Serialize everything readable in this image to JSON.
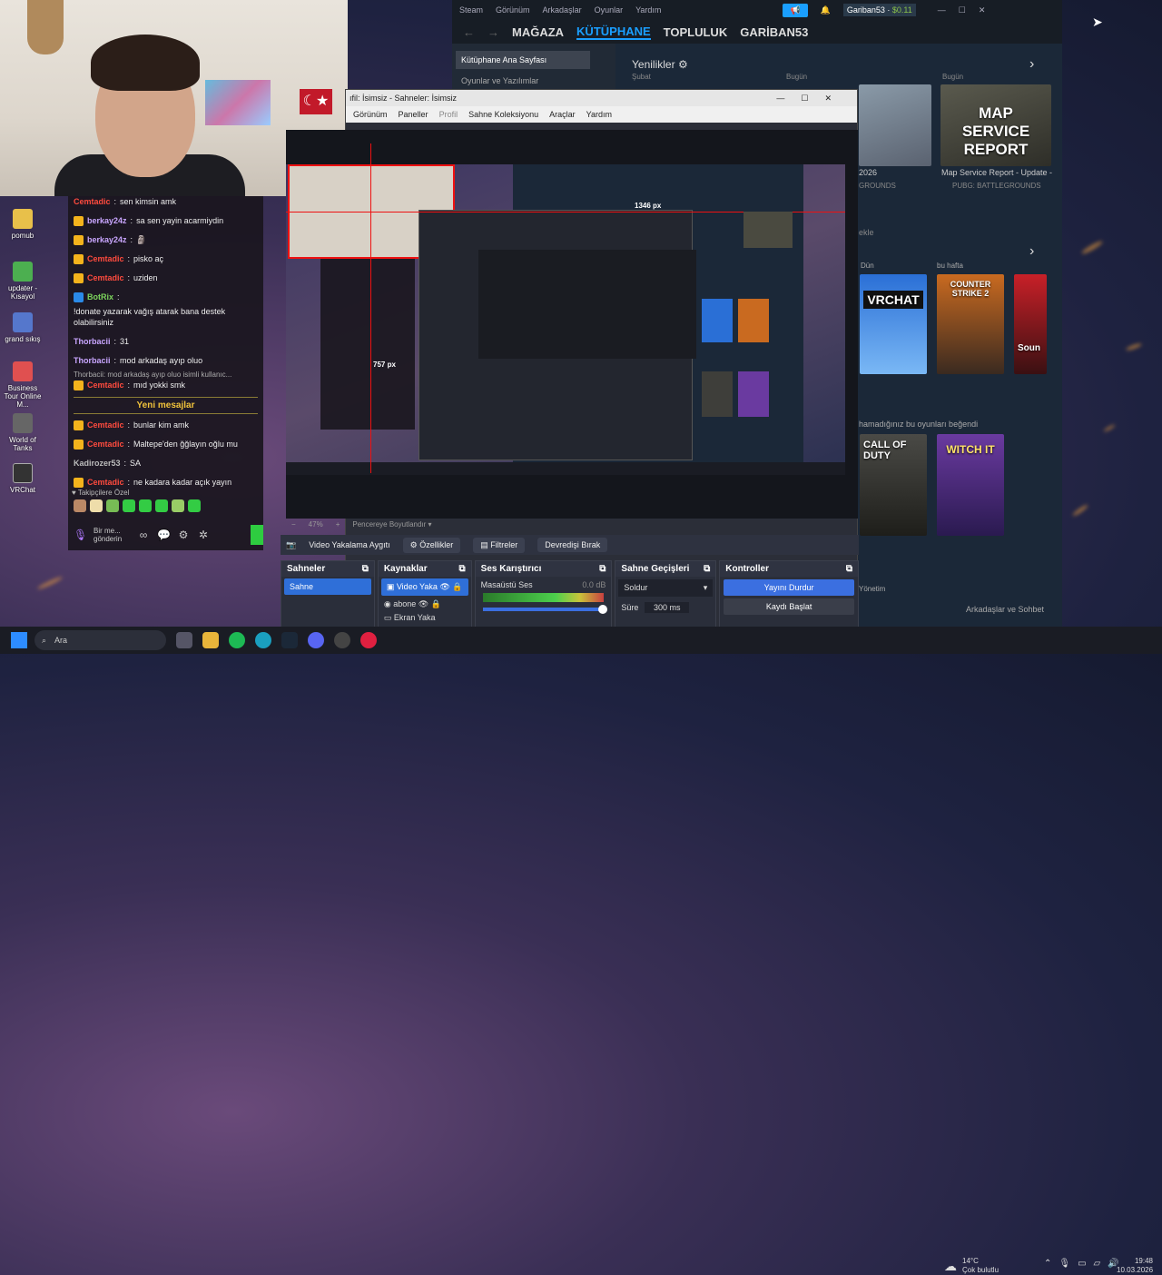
{
  "webcam": {
    "flag": "☾★"
  },
  "chat": {
    "messages": [
      {
        "user": "Cemtadic",
        "text": "sen kimsin amk",
        "color": "red"
      },
      {
        "user": "berkay24z",
        "text": "sa sen yayin acarmiydin",
        "color": "purple"
      },
      {
        "user": "berkay24z",
        "text": "🗿",
        "color": "purple"
      },
      {
        "user": "Cemtadic",
        "text": "pisko aç",
        "color": "red"
      },
      {
        "user": "Cemtadic",
        "text": "uziden",
        "color": "red"
      },
      {
        "user": "BotRix",
        "text": "!donate yazarak vağış atarak bana destek olabilirsiniz",
        "color": "green"
      },
      {
        "user": "Thorbacii",
        "text": "31",
        "color": "purple"
      },
      {
        "user": "Thorbacii",
        "text": "mod arkadaş ayıp oluo",
        "color": "purple"
      }
    ],
    "reply_preview": "Thorbacii: mod arkadaş ayıp oluo isimli kullanıc...",
    "reply_message": {
      "user": "Cemtadic",
      "text": "mıd yokki smk"
    },
    "new_messages_label": "Yeni mesajlar",
    "messages2": [
      {
        "user": "Cemtadic",
        "text": "bunlar kim amk",
        "color": "red"
      },
      {
        "user": "Cemtadic",
        "text": "Maltepe'den ğğlayın oğlu mu",
        "color": "red"
      },
      {
        "user": "Kadirozer53",
        "text": "SA",
        "color": "gray"
      },
      {
        "user": "Cemtadic",
        "text": "ne kadara kadar açık yayın",
        "color": "red"
      }
    ],
    "followers_label": "♥ Takipçilere Özel",
    "input_placeholder": "Bir me... gönderin"
  },
  "desktop_icons": [
    {
      "label": "pomub",
      "color": "#e8c04a"
    },
    {
      "label": "updater - Kısayol",
      "color": "#4caf50"
    },
    {
      "label": "grand sıkış",
      "color": "#5577cc"
    },
    {
      "label": "Business Tour Online M...",
      "color": "#e05050"
    },
    {
      "label": "World of Tanks",
      "color": "#666"
    },
    {
      "label": "VRChat",
      "color": "#333"
    }
  ],
  "steam": {
    "menu": [
      "Steam",
      "Görünüm",
      "Arkadaşlar",
      "Oyunlar",
      "Yardım"
    ],
    "user": "Gariban53",
    "wallet": "$0.11",
    "nav": [
      "MAĞAZA",
      "KÜTÜPHANE",
      "TOPLULUK",
      "GARİBAN53"
    ],
    "home_label": "Kütüphane Ana Sayfası",
    "filter_label": "Oyunlar ve Yazılımlar",
    "whats_new": "Yenilikler",
    "month_label": "Şubat",
    "today_label": "Bugün",
    "today_label2": "Bugün",
    "news_date": "2026",
    "news_source": "GROUNDS",
    "news_title": "Map Service Report - Update -",
    "news_game": "PUBG: BATTLEGROUNDS",
    "map_tile_text": "MAP SERVICE REPORT",
    "add_shelf": "ekle",
    "yesterday": "Dün",
    "this_week": "bu hafta",
    "unplayed": "hamadığınız bu oyunları beğendi",
    "vrchat": "VRCHAT",
    "cs2": "COUNTER STRIKE 2",
    "cod": "CALL OF DUTY",
    "witch": "WITCH IT",
    "sound": "Soun",
    "manage": "Yönetim",
    "friends_chat": "Arkadaşlar ve Sohbet"
  },
  "obs": {
    "title": "ıfil: İsimsiz - Sahneler: İsimsiz",
    "menu": [
      "Görünüm",
      "Paneller",
      "Profil",
      "Sahne Koleksiyonu",
      "Araçlar",
      "Yardım"
    ],
    "px_label": "1346 px",
    "px_label2": "757 px",
    "zoom": "47%",
    "zoom_mode": "Pencereye Boyutlandır",
    "source_name": "Video Yakalama Aygıtı",
    "props": "Özellikler",
    "filters": "Filtreler",
    "deactivate": "Devredişi Bırak",
    "scenes_title": "Sahneler",
    "scene": "Sahne",
    "sources_title": "Kaynaklar",
    "sources": [
      "Video Yaka",
      "abone",
      "Ekran Yaka"
    ],
    "mixer_title": "Ses Karıştırıcı",
    "mixer_track": "Masaüstü Ses",
    "mixer_db": "0.0 dB",
    "transitions_title": "Sahne Geçişleri",
    "transition": "Soldur",
    "duration_label": "Süre",
    "duration": "300 ms",
    "controls_title": "Kontroller",
    "stop_stream": "Yayını Durdur",
    "record": "Kaydı Başlat"
  },
  "taskbar": {
    "search": "Ara",
    "weather_temp": "14°C",
    "weather_desc": "Çok bulutlu",
    "time": "19:48",
    "date": "10.03.2026"
  }
}
